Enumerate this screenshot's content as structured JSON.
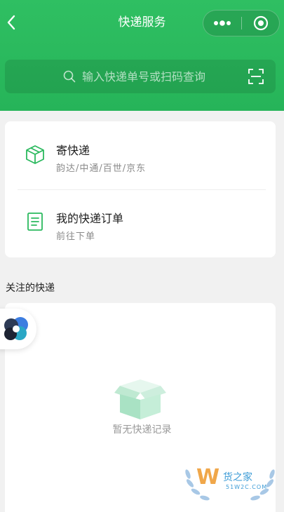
{
  "header": {
    "title": "快递服务",
    "accent_color": "#2bb95e"
  },
  "search": {
    "placeholder": "输入快递单号或扫码查询"
  },
  "menu": {
    "items": [
      {
        "title": "寄快递",
        "subtitle": "韵达/中通/百世/京东",
        "icon": "package-icon"
      },
      {
        "title": "我的快递订单",
        "subtitle": "前往下单",
        "icon": "document-icon"
      }
    ]
  },
  "followed": {
    "label": "关注的快递",
    "empty_text": "暂无快递记录"
  },
  "watermark": {
    "brand": "货之家",
    "site": "51W2C.COM"
  }
}
